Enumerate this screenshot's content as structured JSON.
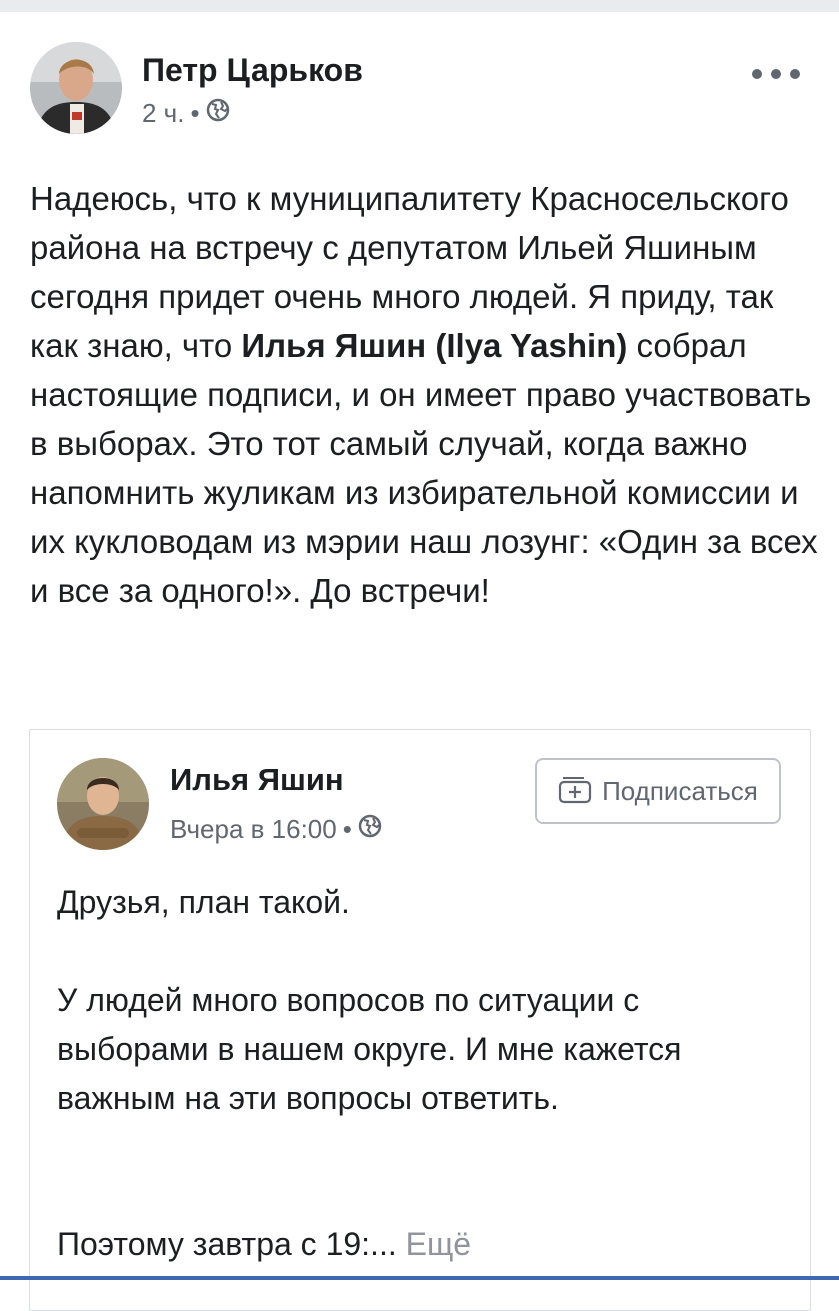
{
  "post": {
    "author_name": "Петр Царьков",
    "time": "2 ч.",
    "separator": "•",
    "privacy_icon": "globe-icon",
    "more_icon": "more-options-icon",
    "text_part1": "Надеюсь, что к муниципалитету Красносельского района на встречу с депутатом Ильей Яшиным сегодня придет очень много людей. Я приду, так как знаю, что ",
    "mention": "Илья Яшин (Ilya Yashin)",
    "text_part2": " собрал настоящие подписи, и он имеет право участвовать в выборах. Это тот самый случай, когда важно напомнить жуликам из избирательной комиссии и их кукловодам из мэрии наш лозунг: «Один за всех и все за одного!». До встречи!"
  },
  "shared_post": {
    "author_name": "Илья Яшин",
    "time": "Вчера в 16:00",
    "separator": "•",
    "privacy_icon": "globe-icon",
    "follow_label": "Подписаться",
    "follow_icon": "follow-plus-icon",
    "paragraph1": "Друзья, план такой.",
    "paragraph2": "У людей много вопросов по ситуации с выборами в нашем округе. И мне кажется важным на эти вопросы ответить.",
    "paragraph3": "Поэтому завтра с 19:...",
    "see_more": "Ещё"
  },
  "colors": {
    "text": "#1c1e21",
    "secondary": "#606770",
    "muted": "#90949c",
    "border": "#dadde1",
    "accent": "#4267b2",
    "feed_background": "#e9ebee"
  }
}
